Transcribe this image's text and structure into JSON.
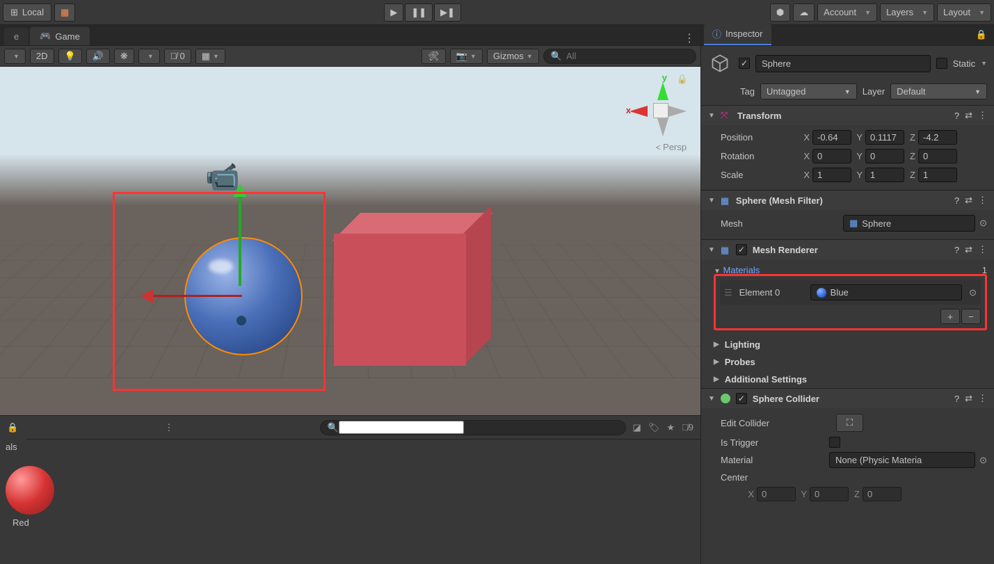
{
  "toolbar": {
    "local": "Local",
    "account": "Account",
    "layers": "Layers",
    "layout": "Layout"
  },
  "tabs": {
    "scene_partial": "e",
    "game": "Game"
  },
  "scene_toolbar": {
    "mode_2d": "2D",
    "hidden_count": "0",
    "gizmos": "Gizmos",
    "search_placeholder": "All"
  },
  "viewport": {
    "axis_x": "x",
    "axis_y": "y",
    "persp": "Persp"
  },
  "project": {
    "tab_label": "als",
    "hidden_count": "9",
    "asset_name": "Red"
  },
  "inspector": {
    "title": "Inspector",
    "object_name": "Sphere",
    "static_label": "Static",
    "tag_label": "Tag",
    "tag_value": "Untagged",
    "layer_label": "Layer",
    "layer_value": "Default",
    "transform": {
      "title": "Transform",
      "position": "Position",
      "rotation": "Rotation",
      "scale": "Scale",
      "pos": {
        "x": "-0.64",
        "y": "0.1117",
        "z": "-4.2"
      },
      "rot": {
        "x": "0",
        "y": "0",
        "z": "0"
      },
      "scl": {
        "x": "1",
        "y": "1",
        "z": "1"
      }
    },
    "mesh_filter": {
      "title": "Sphere (Mesh Filter)",
      "mesh_label": "Mesh",
      "mesh_value": "Sphere"
    },
    "mesh_renderer": {
      "title": "Mesh Renderer",
      "materials_label": "Materials",
      "materials_count": "1",
      "element0_label": "Element 0",
      "element0_value": "Blue"
    },
    "lighting": "Lighting",
    "probes": "Probes",
    "additional": "Additional Settings",
    "sphere_collider": {
      "title": "Sphere Collider",
      "edit_label": "Edit Collider",
      "is_trigger": "Is Trigger",
      "material_label": "Material",
      "material_value": "None (Physic Materia",
      "center_label": "Center",
      "center": {
        "x": "0",
        "y": "0",
        "z": "0"
      }
    }
  }
}
